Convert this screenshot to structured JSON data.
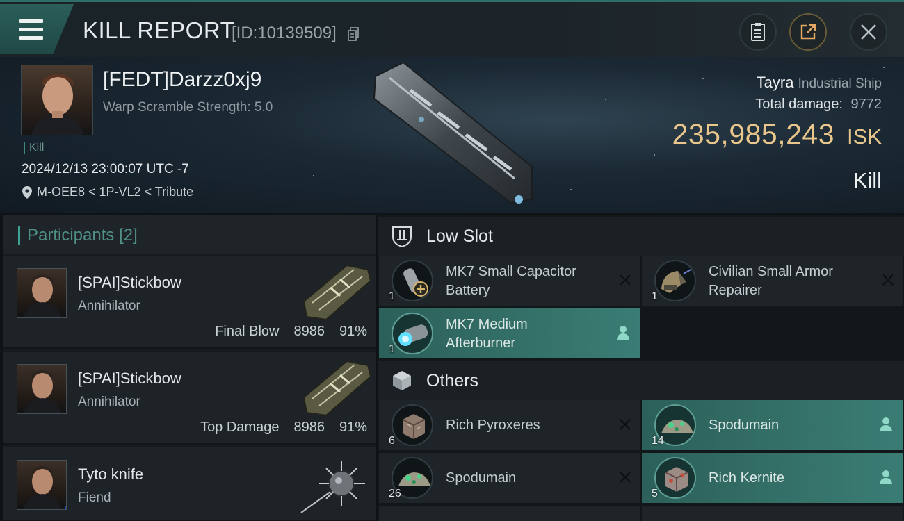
{
  "header": {
    "title": "KILL REPORT",
    "report_id": "[ID:10139509]"
  },
  "victim": {
    "name": "[FEDT]Darzz0xj9",
    "warp_scramble": "Warp Scramble Strength: 5.0",
    "tag": "Kill",
    "datetime": "2024/12/13 23:00:07 UTC -7",
    "location": "M-OEE8 < 1P-VL2 < Tribute",
    "ship_name": "Tayra",
    "ship_class": "Industrial Ship",
    "total_damage_label": "Total damage:",
    "total_damage": "9772",
    "isk_value": "235,985,243",
    "isk_unit": "ISK",
    "result": "Kill"
  },
  "participants": {
    "label": "Participants",
    "count": "[2]",
    "list": [
      {
        "name": "[SPAI]Stickbow",
        "ship": "Annihilator",
        "role": "Final Blow",
        "damage": "8986",
        "percent": "91%"
      },
      {
        "name": "[SPAI]Stickbow",
        "ship": "Annihilator",
        "role": "Top Damage",
        "damage": "8986",
        "percent": "91%"
      },
      {
        "name": "Tyto knife",
        "ship": "Fiend"
      }
    ]
  },
  "low_slot": {
    "label": "Low Slot",
    "items": [
      {
        "name_line1": "MK7 Small Capacitor",
        "name_line2": "Battery",
        "qty": "1",
        "status": "destroyed"
      },
      {
        "name_line1": "Civilian Small Armor",
        "name_line2": "Repairer",
        "qty": "1",
        "status": "destroyed"
      },
      {
        "name_line1": "MK7 Medium",
        "name_line2": "Afterburner",
        "qty": "1",
        "status": "dropped"
      }
    ]
  },
  "others": {
    "label": "Others",
    "items": [
      {
        "name": "Rich Pyroxeres",
        "qty": "6",
        "status": "destroyed"
      },
      {
        "name": "Spodumain",
        "qty": "14",
        "status": "dropped"
      },
      {
        "name": "Spodumain",
        "qty": "26",
        "status": "destroyed"
      },
      {
        "name": "Rich Kernite",
        "qty": "5",
        "status": "dropped"
      }
    ]
  },
  "colors": {
    "accent_teal": "#3a7d74",
    "isk_gold": "#e9c68b",
    "corp_badge_blue": "#1d4fb8"
  }
}
